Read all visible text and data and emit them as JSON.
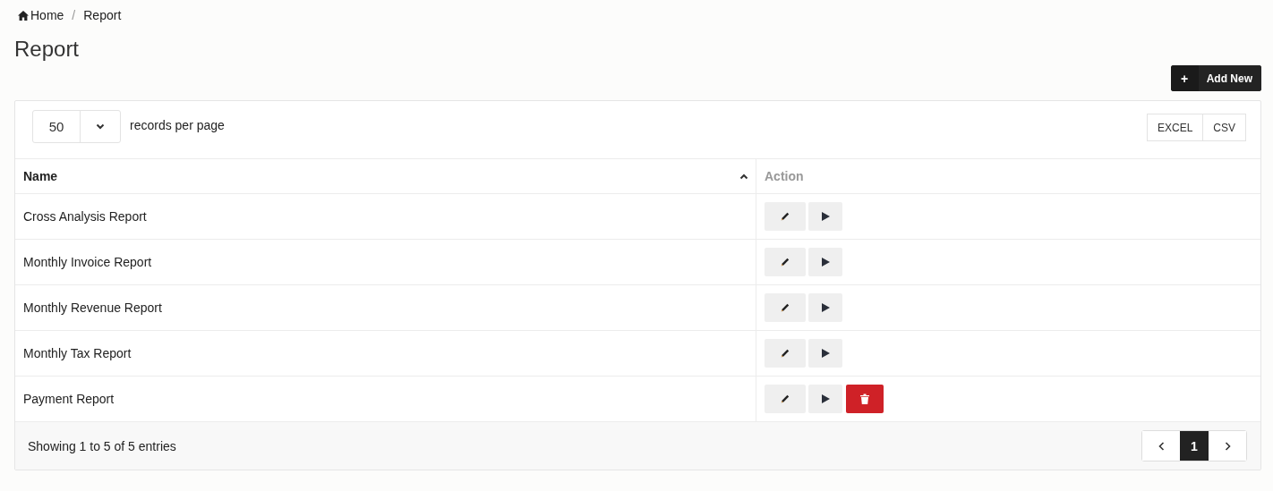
{
  "breadcrumb": [
    {
      "label": "Home",
      "kind": "home"
    },
    {
      "label": "/",
      "kind": "separator"
    },
    {
      "label": "Report",
      "kind": "current"
    }
  ],
  "title": "Report",
  "add_button": {
    "icon": "+",
    "label": "Add New"
  },
  "page_size": {
    "value": "50",
    "label": "records per page"
  },
  "export_buttons": [
    "EXCEL",
    "CSV"
  ],
  "table": {
    "columns": [
      {
        "label": "Name",
        "sorted": true
      },
      {
        "label": "Action",
        "sorted": false
      }
    ],
    "rows": [
      {
        "name": "Cross Analysis Report",
        "deletable": false
      },
      {
        "name": "Monthly Invoice Report",
        "deletable": false
      },
      {
        "name": "Monthly Revenue Report",
        "deletable": false
      },
      {
        "name": "Monthly Tax Report",
        "deletable": false
      },
      {
        "name": "Payment Report",
        "deletable": true
      }
    ]
  },
  "footer": {
    "info": "Showing 1 to 5 of 5 entries",
    "pages": [
      {
        "label": "1",
        "selected": true
      }
    ]
  }
}
